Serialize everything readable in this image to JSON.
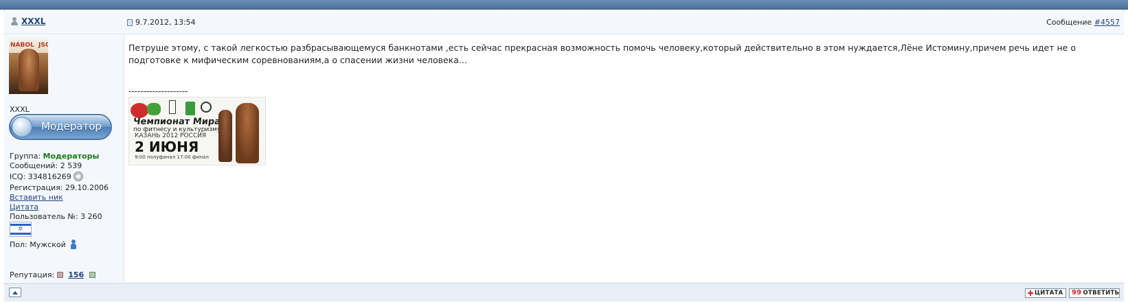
{
  "post": {
    "author": "XXXL",
    "date": "9.7.2012, 13:54",
    "number_prefix": "Сообщение",
    "number_link": "#4557",
    "body": "Петруше этому, с такой легкостью разбрасывающемуся банкнотами ,есть сейчас прекрасная возможность помочь человеку,который действительно в этом нуждается,Лёне Истомину,причем речь идет не о подготовке к мифическим соревнованиям,а о спасении жизни человека...",
    "signature_line": "--------------------"
  },
  "profile": {
    "avatar_banner_text": "NABOL  JSC",
    "nick": "XXXL",
    "badge": "Модератор",
    "group_label": "Группа:",
    "group_value": "Модераторы",
    "posts": "Сообщений: 2 539",
    "icq": "ICQ: 334816269",
    "registration": "Регистрация: 29.10.2006",
    "insert_nick": "Вставить ник",
    "quote_link": "Цитата",
    "user_number": "Пользователь №: 3 260",
    "gender": "Пол: Мужской",
    "reputation_label": "Репутация:",
    "reputation_value": "156",
    "flag_star": "✡"
  },
  "signature_banner": {
    "title1": "Чемпионат Мира",
    "title2": "по фитнесу и культуризму",
    "city": "КАЗАНЬ 2012 РОССИЯ",
    "date": "2 ИЮНЯ",
    "schedule": "9:00 полуфинал 17:00 финал"
  },
  "footer": {
    "quote_button": "ЦИТАТА",
    "reply_button": "ОТВЕТИТЬ",
    "reply_icon": "99"
  },
  "icons": [
    "user-icon",
    "doc-icon",
    "flower-icon",
    "male-icon",
    "arrow-up-icon",
    "plus-icon",
    "quote-icon"
  ]
}
